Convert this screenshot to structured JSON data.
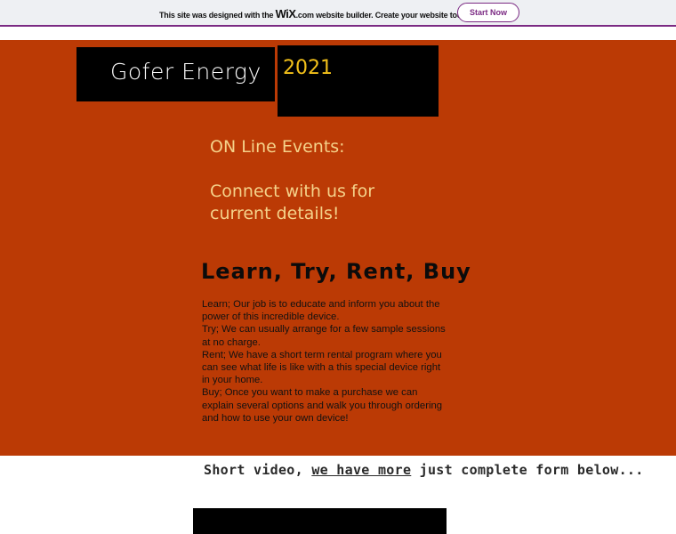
{
  "wix_banner": {
    "text_before": "This site was designed with the ",
    "logo": "WiX",
    "logo_suffix": ".com",
    "text_after": " website builder. Create your website today.",
    "button_label": "Start Now",
    "accent_color": "#7b2a83"
  },
  "header": {
    "site_title": "Gofer Energy",
    "year": "2021"
  },
  "events": {
    "line1": "ON Line Events:",
    "line2": "Connect with us for",
    "line3": "current details!"
  },
  "learn": {
    "heading": "Learn, Try, Rent, Buy",
    "paragraphs": [
      "Learn; Our job is to educate and inform you about the power of this incredible device.",
      "Try; We can usually arrange for a few sample sessions at no charge.",
      "Rent; We have a short term rental program where you can see what life is like with a this special device right in your home.",
      "Buy; Once you want to make a purchase we can explain several options and walk you through ordering and how to use your own device!"
    ]
  },
  "video": {
    "caption_before": "Short video, ",
    "caption_link": "we have more",
    "caption_after": " just complete form below..."
  },
  "colors": {
    "hero_background": "#bb3a05",
    "year_color": "#f2c01a",
    "events_color": "#f5d28a"
  }
}
